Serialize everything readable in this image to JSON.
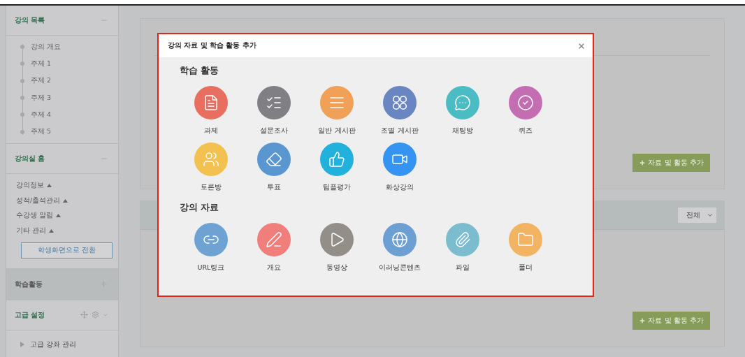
{
  "sidebar": {
    "course_list": {
      "title": "강의 목록",
      "items": [
        "강의 개요",
        "주제 1",
        "주제 2",
        "주제 3",
        "주제 4",
        "주제 5"
      ]
    },
    "classroom_home": {
      "title": "강의실 홈",
      "menu": [
        "강의정보",
        "성적/출석관리",
        "수강생 알림",
        "기타 관리"
      ],
      "button": "학생화면으로 전환"
    },
    "learning_activity": {
      "title": "학습활동"
    },
    "advanced": {
      "title": "고급 설정",
      "items": [
        "고급 강좌 관리"
      ]
    }
  },
  "main": {
    "cards": [
      {
        "button": "자료 및 활동 추가"
      },
      {
        "filter": "전체",
        "button": "자료 및 활동 추가"
      }
    ]
  },
  "modal": {
    "title": "강의 자료 및 학습 활동 추가",
    "sections": [
      {
        "title": "학습 활동",
        "items": [
          {
            "label": "과제",
            "color": "#e86f5f"
          },
          {
            "label": "설문조사",
            "color": "#7f7f84"
          },
          {
            "label": "일반 게시판",
            "color": "#f0a057"
          },
          {
            "label": "조별 게시판",
            "color": "#6a86c2"
          },
          {
            "label": "채팅방",
            "color": "#4bbcc4"
          },
          {
            "label": "퀴즈",
            "color": "#c56db3"
          },
          {
            "label": "토론방",
            "color": "#f2c150"
          },
          {
            "label": "투표",
            "color": "#5a97d0"
          },
          {
            "label": "팀플평가",
            "color": "#22b0dd"
          },
          {
            "label": "화상강의",
            "color": "#3594f2"
          }
        ]
      },
      {
        "title": "강의 자료",
        "items": [
          {
            "label": "URL링크",
            "color": "#6ea2d2"
          },
          {
            "label": "개요",
            "color": "#f07f7c"
          },
          {
            "label": "동영상",
            "color": "#938f88"
          },
          {
            "label": "이러닝콘텐츠",
            "color": "#6e9fd2"
          },
          {
            "label": "파일",
            "color": "#7bbccf"
          },
          {
            "label": "폴더",
            "color": "#f2b462"
          }
        ]
      }
    ]
  }
}
